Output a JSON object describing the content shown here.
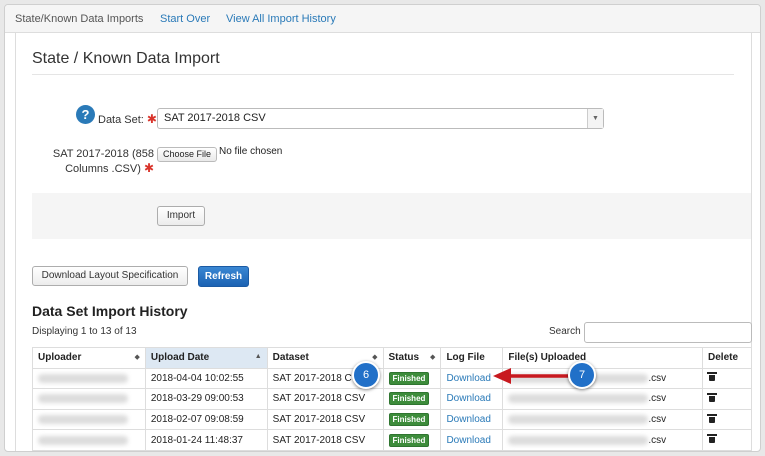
{
  "nav": {
    "brand": "State/Known Data Imports",
    "start_over": "Start Over",
    "view_history": "View All Import History"
  },
  "page_title": "State / Known Data Import",
  "form": {
    "dataset_label": "Data Set:",
    "dataset_value": "SAT 2017-2018 CSV",
    "file_label_line1": "SAT 2017-2018 (858",
    "file_label_line2": "Columns .CSV)",
    "required_mark": "✱",
    "help_glyph": "?",
    "choose_file": "Choose File",
    "no_file": "No file chosen",
    "import_button": "Import"
  },
  "actions": {
    "download_layout": "Download Layout Specification",
    "refresh": "Refresh"
  },
  "history": {
    "title": "Data Set Import History",
    "count": "Displaying 1 to 13 of 13",
    "search_label": "Search",
    "columns": [
      "Uploader",
      "Upload Date",
      "Dataset",
      "Status",
      "Log File",
      "File(s) Uploaded",
      "Delete"
    ],
    "rows": [
      {
        "date": "2018-04-04 10:02:55",
        "dataset": "SAT 2017-2018 C",
        "status": "Finished",
        "log": "Download",
        "file_suffix": ".csv"
      },
      {
        "date": "2018-03-29 09:00:53",
        "dataset": "SAT 2017-2018 CSV",
        "status": "Finished",
        "log": "Download",
        "file_suffix": ".csv"
      },
      {
        "date": "2018-02-07 09:08:59",
        "dataset": "SAT 2017-2018 CSV",
        "status": "Finished",
        "log": "Download",
        "file_suffix": ".csv"
      },
      {
        "date": "2018-01-24 11:48:37",
        "dataset": "SAT 2017-2018 CSV",
        "status": "Finished",
        "log": "Download",
        "file_suffix": ".csv"
      }
    ]
  },
  "callouts": {
    "step6": "6",
    "step7": "7"
  },
  "colors": {
    "link": "#2a7ab8",
    "primary": "#1b62b3",
    "status_finished": "#3d8c3b",
    "callout": "#2170c8",
    "arrow": "#c8191f"
  }
}
